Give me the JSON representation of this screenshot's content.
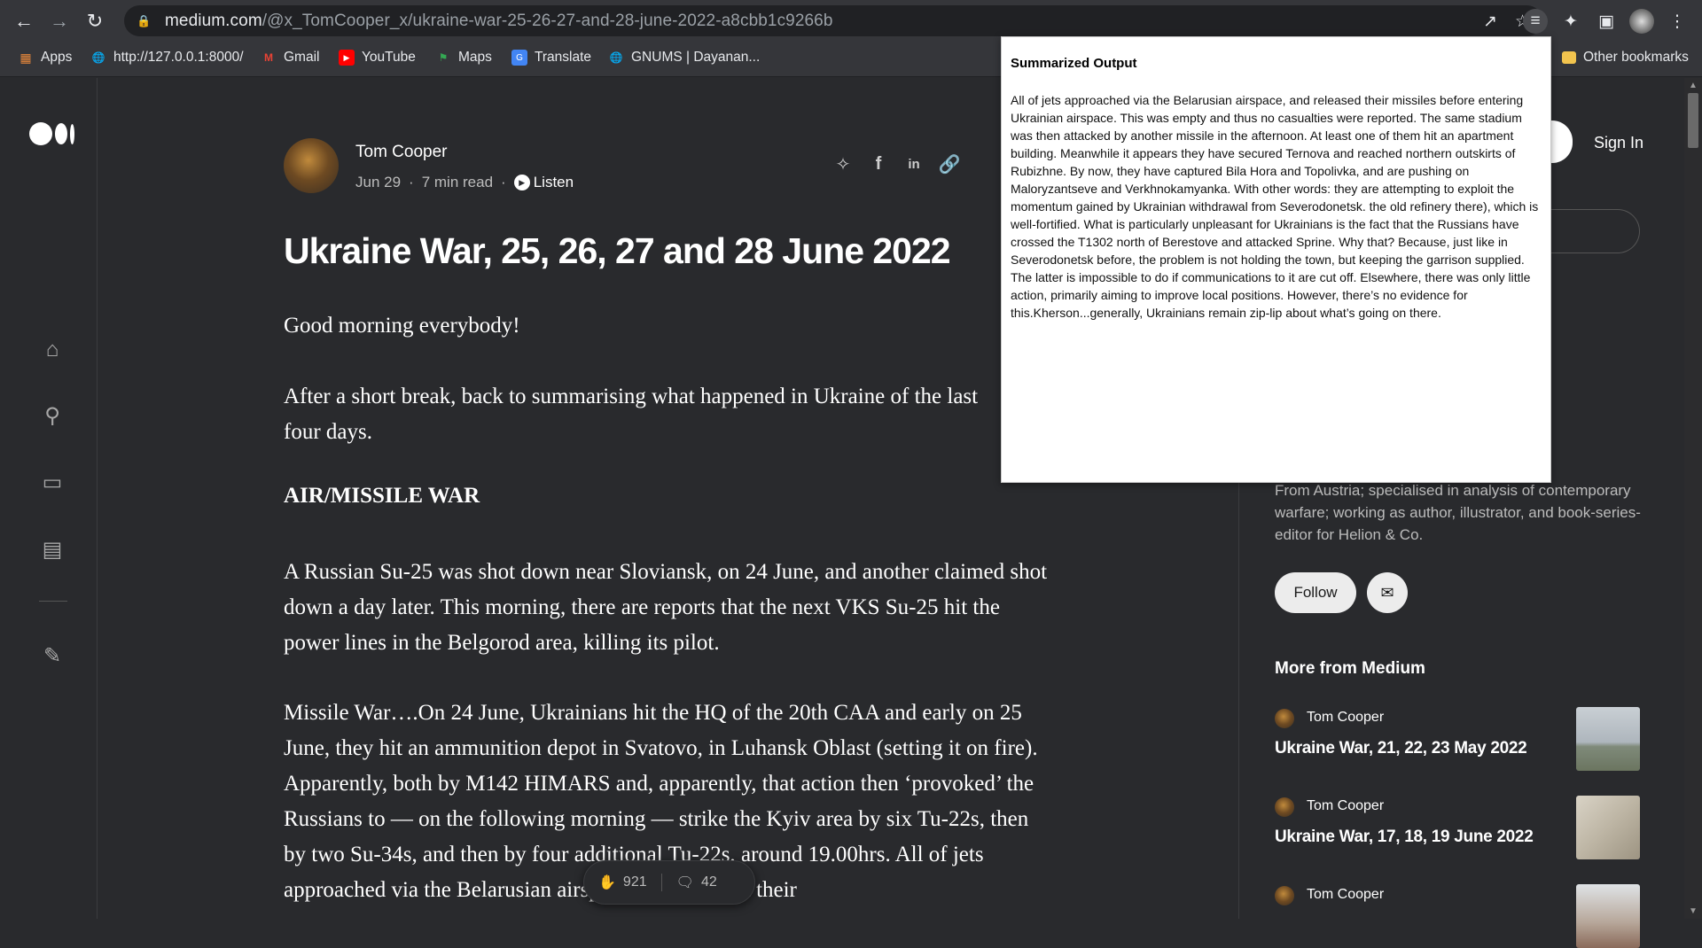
{
  "browser": {
    "url_host": "medium.com",
    "url_path": "/@x_TomCooper_x/ukraine-war-25-26-27-and-28-june-2022-a8cbb1c9266b",
    "bookmarks": [
      "Apps",
      "http://127.0.0.1:8000/",
      "Gmail",
      "YouTube",
      "Maps",
      "Translate",
      "GNUMS | Dayanan..."
    ],
    "other_bookmarks": "Other bookmarks"
  },
  "article": {
    "author": "Tom Cooper",
    "date": "Jun 29",
    "dot": "·",
    "read_time": "7 min read",
    "listen": "Listen",
    "title": "Ukraine War, 25, 26, 27 and 28 June 2022",
    "p1": "Good morning everybody!",
    "p2": "After a short break, back to summarising what happened in Ukraine of the last four days.",
    "h1": "AIR/MISSILE WAR",
    "p3": "A Russian Su-25 was shot down near Sloviansk, on 24 June, and another claimed shot down a day later. This morning, there are reports that the next VKS Su-25 hit the power lines in the Belgorod area, killing its pilot.",
    "p4": "Missile War….On 24 June, Ukrainians hit the HQ of the 20th CAA and early on 25 June, they hit an ammunition depot in Svatovo, in Luhansk Oblast (setting it on fire). Apparently, both by M142 HIMARS and, apparently, that action then ‘provoked’ the Russians to — on the following morning — strike the Kyiv area by six Tu-22s, then by two Su-34s, and then by four additional Tu-22s, around 19.00hrs. All of jets approached via the Belarusian airspace, and released their"
  },
  "clap_bar": {
    "claps": "921",
    "responses": "42"
  },
  "sidebar": {
    "sign_in": "Sign In",
    "bio": "From Austria; specialised in analysis of contemporary warfare; working as author, illustrator, and book-series-editor for Helion & Co.",
    "follow": "Follow",
    "more_title": "More from Medium",
    "more_items": [
      {
        "author": "Tom Cooper",
        "title": "Ukraine War, 21, 22, 23 May 2022"
      },
      {
        "author": "Tom Cooper",
        "title": "Ukraine War, 17, 18, 19 June 2022"
      },
      {
        "author": "Tom Cooper",
        "title": ""
      }
    ]
  },
  "popup": {
    "title": "Summarized Output",
    "body": "All of jets approached via the Belarusian airspace, and released their missiles before entering Ukrainian airspace. This was empty and thus no casualties were reported. The same stadium was then attacked by another missile in the afternoon. At least one of them hit an apartment building. Meanwhile it appears they have secured Ternova and reached northern outskirts of Rubizhne. By now, they have captured Bila Hora and Topolivka, and are pushing on Maloryzantseve and Verkhnokamyanka. With other words: they are attempting to exploit the momentum gained by Ukrainian withdrawal from Severodonetsk. the old refinery there), which is well-fortified. What is particularly unpleasant for Ukrainians is the fact that the Russians have crossed the T1302 north of Berestove and attacked Sprine. Why that? Because, just like in Severodonetsk before, the problem is not holding the town, but keeping the garrison supplied. The latter is impossible to do if communications to it are cut off. Elsewhere, there was only little action, primarily aiming to improve local positions. However, there’s no evidence for this.Kherson...generally, Ukrainians remain zip-lip about what’s going on there."
  },
  "colors": {
    "page_bg": "#292a2d",
    "chrome_bg": "#35363a",
    "omnibox_bg": "#202124",
    "popup_bg": "#ffffff"
  }
}
